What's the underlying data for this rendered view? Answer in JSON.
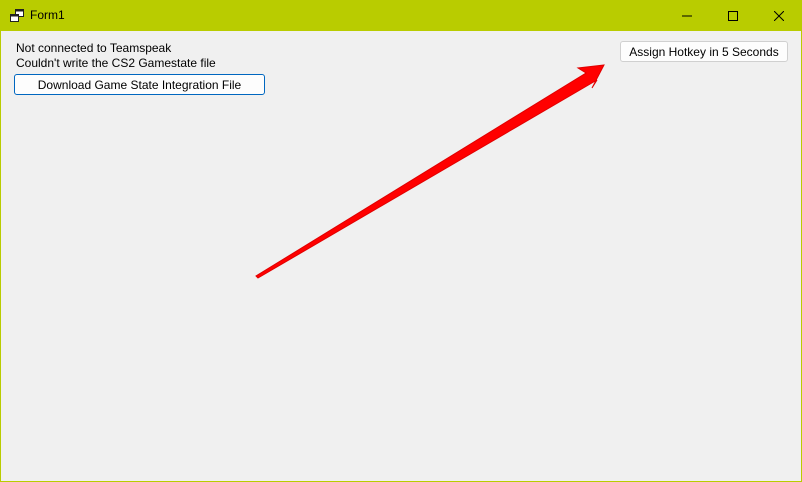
{
  "window": {
    "title": "Form1",
    "app_icon": "windows-forms-app-icon",
    "frame_color": "#b9cc00",
    "client_color": "#f0f0f0",
    "caption_buttons": [
      "minimize-icon",
      "maximize-icon",
      "close-icon"
    ]
  },
  "status": {
    "teamspeak": "Not connected to Teamspeak",
    "gamestate": "Couldn't write the CS2 Gamestate file"
  },
  "buttons": {
    "download": "Download Game State Integration File",
    "assign_hotkey": "Assign Hotkey in 5 Seconds"
  },
  "annotation": {
    "arrow_color": "#ff0000",
    "points_to": "assign-hotkey-button"
  }
}
